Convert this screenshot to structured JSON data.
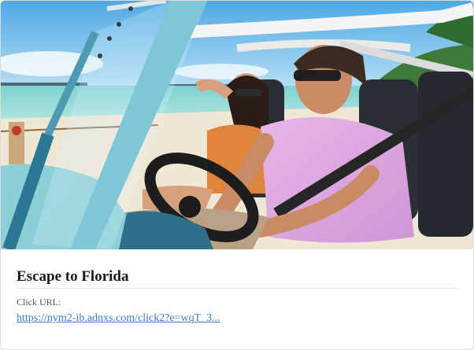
{
  "card": {
    "image_alt": "Couple driving an open-top jeep along a Florida beach",
    "title": "Escape to Florida",
    "url_label": "Click URL:",
    "url_text": "https://nym2-ib.adnxs.com/click2?e=wqT_3..."
  },
  "colors": {
    "link": "#3a78c9",
    "title": "#1a1a1a",
    "label": "#555555"
  }
}
